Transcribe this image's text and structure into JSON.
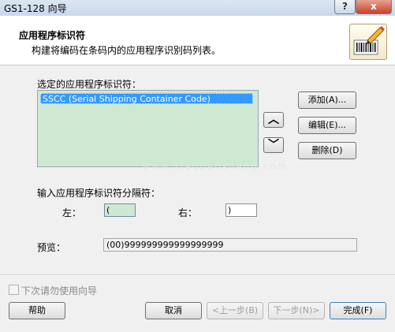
{
  "window": {
    "title": "GS1-128 向导",
    "help_glyph": "?",
    "close_glyph": "x"
  },
  "header": {
    "title": "应用程序标识符",
    "description": "构建将编码在条码内的应用程序识别码列表。",
    "logo_icon": "barcode-pen-icon"
  },
  "selected_ai": {
    "label": "选定的应用程序标识符：",
    "items": [
      "SSCC (Serial Shipping Container Code)"
    ]
  },
  "watermark": "www.xiaobaoshang.com",
  "buttons": {
    "add": "添加(A)...",
    "edit": "编辑(E)...",
    "delete": "删除(D)",
    "move_up": "︿",
    "move_down": "﹀"
  },
  "separator": {
    "label": "输入应用程序标识符分隔符：",
    "left_label": "左：",
    "left_value": "(",
    "right_label": "右：",
    "right_value": ")"
  },
  "preview": {
    "label": "预览：",
    "value": "(00)999999999999999999"
  },
  "footer": {
    "dont_show_label": "下次请勿使用向导",
    "dont_show_checked": false,
    "help": "帮助",
    "cancel": "取消",
    "back": "<上一步(B)",
    "next": "下一步(N)>",
    "finish": "完成(F)"
  }
}
